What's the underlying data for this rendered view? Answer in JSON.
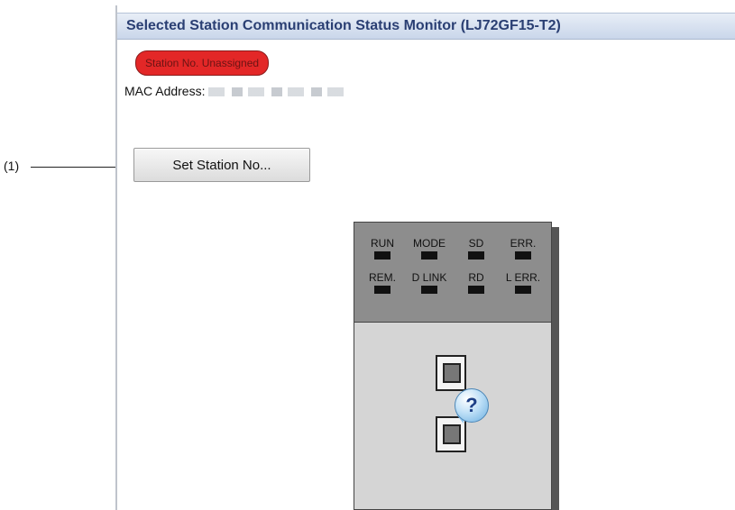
{
  "callout": {
    "label": "(1)"
  },
  "panel": {
    "title": "Selected Station Communication Status Monitor (LJ72GF15-T2)",
    "station_badge": "Station No. Unassigned",
    "mac_label": "MAC Address:",
    "set_button_label": "Set Station No..."
  },
  "device": {
    "leds": [
      {
        "label": "RUN"
      },
      {
        "label": "MODE"
      },
      {
        "label": "SD"
      },
      {
        "label": "ERR."
      },
      {
        "label": "REM."
      },
      {
        "label": "D LINK"
      },
      {
        "label": "RD"
      },
      {
        "label": "L ERR."
      }
    ],
    "status_symbol": "?"
  },
  "colors": {
    "badge": "#e32727",
    "title_text": "#2a3f73",
    "device_top": "#8d8d8d",
    "device_bottom": "#d5d5d5"
  },
  "icons": [
    "ethernet-port-icon",
    "question-bubble-icon"
  ]
}
